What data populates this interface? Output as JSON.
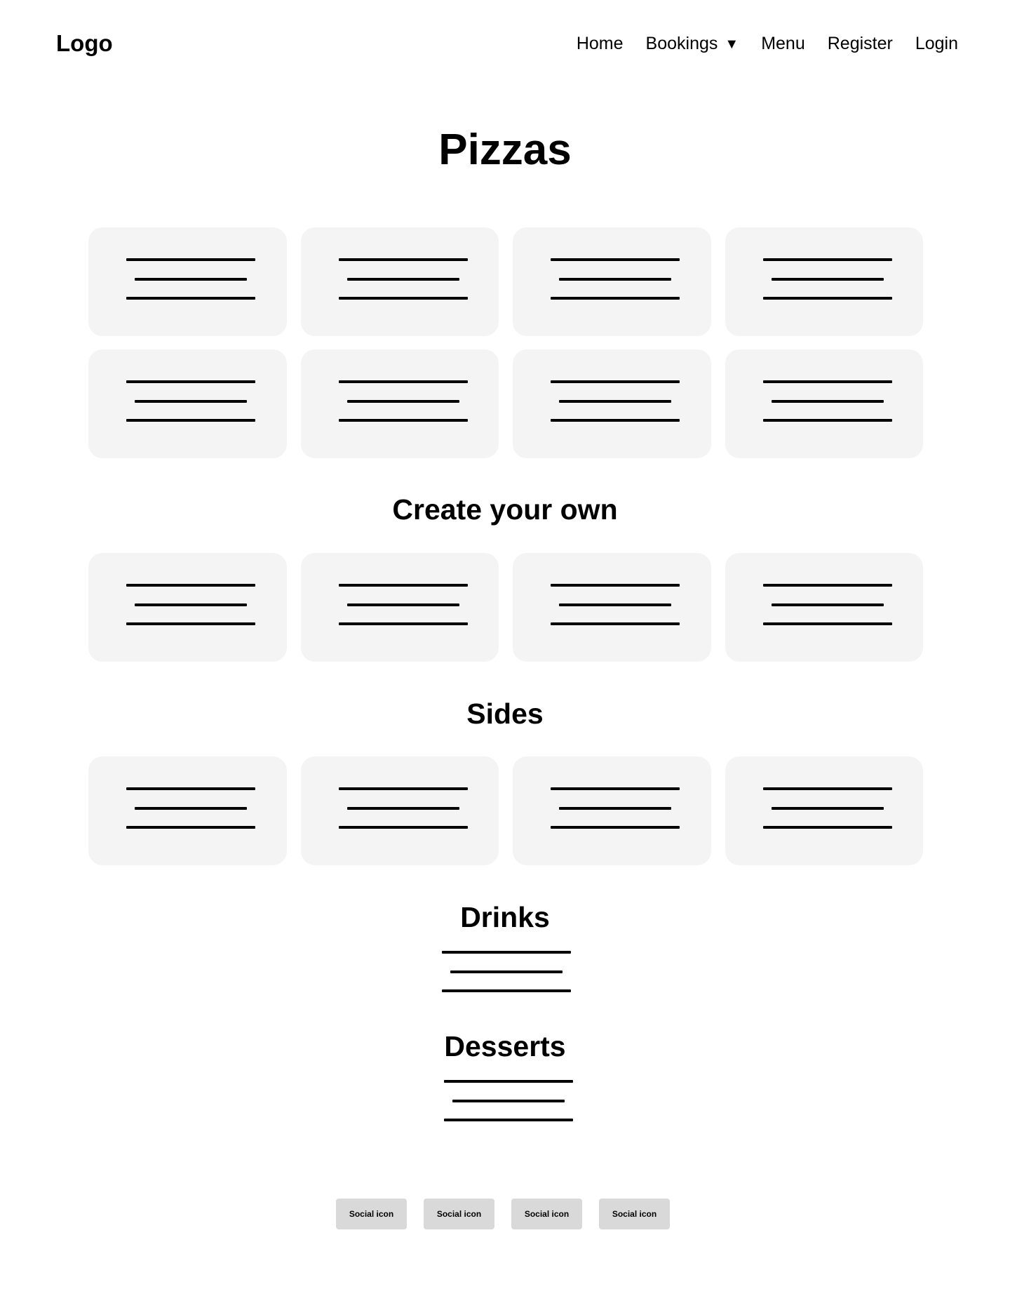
{
  "header": {
    "logo": "Logo",
    "nav": [
      {
        "label": "Home"
      },
      {
        "label": "Bookings",
        "caret": "▼"
      },
      {
        "label": "Menu"
      },
      {
        "label": "Register"
      },
      {
        "label": "Login"
      }
    ]
  },
  "sections": {
    "pizzas": {
      "title": "Pizzas"
    },
    "create_your_own": {
      "title": "Create your own"
    },
    "sides": {
      "title": "Sides"
    },
    "drinks": {
      "title": "Drinks"
    },
    "desserts": {
      "title": "Desserts"
    }
  },
  "footer": {
    "social": [
      "Social icon",
      "Social icon",
      "Social icon",
      "Social icon"
    ]
  },
  "colors": {
    "card_background": "#f4f4f4",
    "social_background": "#d9d9d9",
    "text": "#000000"
  }
}
